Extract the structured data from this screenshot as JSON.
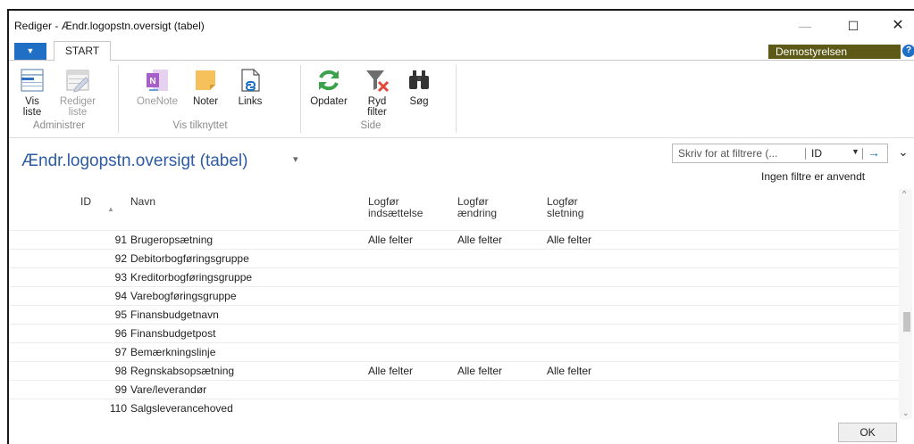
{
  "window": {
    "title": "Rediger - Ændr.logopstn.oversigt (tabel)",
    "minimize_glyph": "—",
    "maximize_glyph": "☐",
    "close_glyph": "✕"
  },
  "ribbon_tabs": {
    "menu_glyph": "▼",
    "start_label": "START"
  },
  "company": "Demostyrelsen",
  "help_glyph": "?",
  "ribbon": {
    "groups": [
      {
        "label": "Administrer",
        "buttons": [
          {
            "label_line1": "Vis",
            "label_line2": "liste",
            "icon": "view-list-icon",
            "enabled": true
          },
          {
            "label_line1": "Rediger",
            "label_line2": "liste",
            "icon": "edit-list-icon",
            "enabled": false
          }
        ]
      },
      {
        "label": "Vis tilknyttet",
        "buttons": [
          {
            "label_line1": "OneNote",
            "label_line2": "",
            "icon": "onenote-icon",
            "enabled": false
          },
          {
            "label_line1": "Noter",
            "label_line2": "",
            "icon": "note-icon",
            "enabled": true
          },
          {
            "label_line1": "Links",
            "label_line2": "",
            "icon": "link-icon",
            "enabled": true
          }
        ]
      },
      {
        "label": "Side",
        "buttons": [
          {
            "label_line1": "Opdater",
            "label_line2": "",
            "icon": "refresh-icon",
            "enabled": true
          },
          {
            "label_line1": "Ryd",
            "label_line2": "filter",
            "icon": "clear-filter-icon",
            "enabled": true
          },
          {
            "label_line1": "Søg",
            "label_line2": "",
            "icon": "binoculars-icon",
            "enabled": true
          }
        ]
      }
    ]
  },
  "page": {
    "title": "Ændr.logopstn.oversigt (tabel)",
    "title_caret": "▾",
    "filter": {
      "placeholder": "Skriv for at filtrere (...",
      "field": "ID",
      "dropdown_glyph": "▼",
      "go_glyph": "→"
    },
    "expand_glyph": "⌄",
    "filter_status": "Ingen filtre er anvendt"
  },
  "grid": {
    "sort_glyph": "▲",
    "columns": {
      "id": "ID",
      "name": "Navn",
      "insert_l1": "Logfør",
      "insert_l2": "indsættelse",
      "change_l1": "Logfør",
      "change_l2": "ændring",
      "delete_l1": "Logfør",
      "delete_l2": "sletning"
    },
    "rows": [
      {
        "id": "91",
        "name": "Brugeropsætning",
        "insert": "Alle felter",
        "change": "Alle felter",
        "delete": "Alle felter"
      },
      {
        "id": "92",
        "name": "Debitorbogføringsgruppe",
        "insert": "",
        "change": "",
        "delete": ""
      },
      {
        "id": "93",
        "name": "Kreditorbogføringsgruppe",
        "insert": "",
        "change": "",
        "delete": ""
      },
      {
        "id": "94",
        "name": "Varebogføringsgruppe",
        "insert": "",
        "change": "",
        "delete": ""
      },
      {
        "id": "95",
        "name": "Finansbudgetnavn",
        "insert": "",
        "change": "",
        "delete": ""
      },
      {
        "id": "96",
        "name": "Finansbudgetpost",
        "insert": "",
        "change": "",
        "delete": ""
      },
      {
        "id": "97",
        "name": "Bemærkningslinje",
        "insert": "",
        "change": "",
        "delete": ""
      },
      {
        "id": "98",
        "name": "Regnskabsopsætning",
        "insert": "Alle felter",
        "change": "Alle felter",
        "delete": "Alle felter"
      },
      {
        "id": "99",
        "name": "Vare/leverandør",
        "insert": "",
        "change": "",
        "delete": ""
      },
      {
        "id": "110",
        "name": "Salgsleverancehoved",
        "insert": "",
        "change": "",
        "delete": ""
      }
    ]
  },
  "scrollbar": {
    "up_glyph": "^",
    "down_glyph": "⌄"
  },
  "ok_label": "OK"
}
